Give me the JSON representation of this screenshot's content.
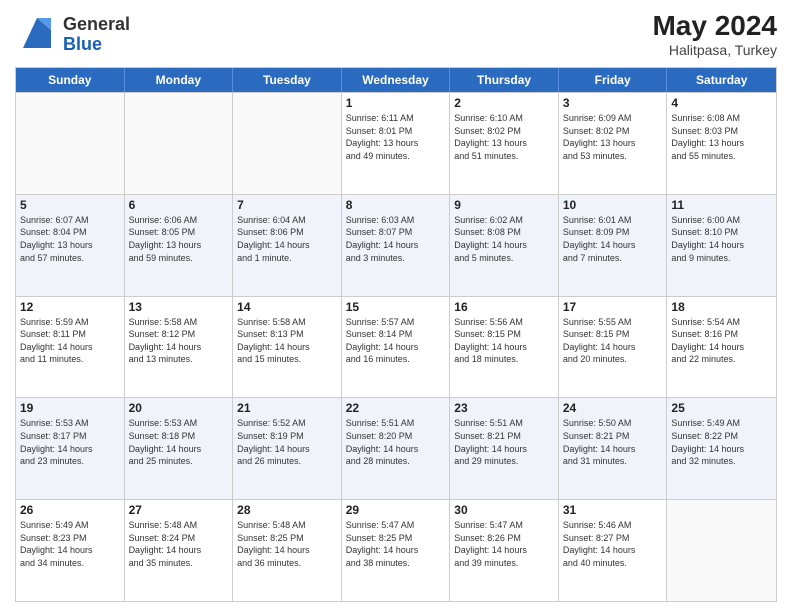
{
  "header": {
    "logo_general": "General",
    "logo_blue": "Blue",
    "month_year": "May 2024",
    "location": "Halitpasa, Turkey"
  },
  "weekdays": [
    "Sunday",
    "Monday",
    "Tuesday",
    "Wednesday",
    "Thursday",
    "Friday",
    "Saturday"
  ],
  "rows": [
    [
      {
        "day": "",
        "info": ""
      },
      {
        "day": "",
        "info": ""
      },
      {
        "day": "",
        "info": ""
      },
      {
        "day": "1",
        "info": "Sunrise: 6:11 AM\nSunset: 8:01 PM\nDaylight: 13 hours\nand 49 minutes."
      },
      {
        "day": "2",
        "info": "Sunrise: 6:10 AM\nSunset: 8:02 PM\nDaylight: 13 hours\nand 51 minutes."
      },
      {
        "day": "3",
        "info": "Sunrise: 6:09 AM\nSunset: 8:02 PM\nDaylight: 13 hours\nand 53 minutes."
      },
      {
        "day": "4",
        "info": "Sunrise: 6:08 AM\nSunset: 8:03 PM\nDaylight: 13 hours\nand 55 minutes."
      }
    ],
    [
      {
        "day": "5",
        "info": "Sunrise: 6:07 AM\nSunset: 8:04 PM\nDaylight: 13 hours\nand 57 minutes."
      },
      {
        "day": "6",
        "info": "Sunrise: 6:06 AM\nSunset: 8:05 PM\nDaylight: 13 hours\nand 59 minutes."
      },
      {
        "day": "7",
        "info": "Sunrise: 6:04 AM\nSunset: 8:06 PM\nDaylight: 14 hours\nand 1 minute."
      },
      {
        "day": "8",
        "info": "Sunrise: 6:03 AM\nSunset: 8:07 PM\nDaylight: 14 hours\nand 3 minutes."
      },
      {
        "day": "9",
        "info": "Sunrise: 6:02 AM\nSunset: 8:08 PM\nDaylight: 14 hours\nand 5 minutes."
      },
      {
        "day": "10",
        "info": "Sunrise: 6:01 AM\nSunset: 8:09 PM\nDaylight: 14 hours\nand 7 minutes."
      },
      {
        "day": "11",
        "info": "Sunrise: 6:00 AM\nSunset: 8:10 PM\nDaylight: 14 hours\nand 9 minutes."
      }
    ],
    [
      {
        "day": "12",
        "info": "Sunrise: 5:59 AM\nSunset: 8:11 PM\nDaylight: 14 hours\nand 11 minutes."
      },
      {
        "day": "13",
        "info": "Sunrise: 5:58 AM\nSunset: 8:12 PM\nDaylight: 14 hours\nand 13 minutes."
      },
      {
        "day": "14",
        "info": "Sunrise: 5:58 AM\nSunset: 8:13 PM\nDaylight: 14 hours\nand 15 minutes."
      },
      {
        "day": "15",
        "info": "Sunrise: 5:57 AM\nSunset: 8:14 PM\nDaylight: 14 hours\nand 16 minutes."
      },
      {
        "day": "16",
        "info": "Sunrise: 5:56 AM\nSunset: 8:15 PM\nDaylight: 14 hours\nand 18 minutes."
      },
      {
        "day": "17",
        "info": "Sunrise: 5:55 AM\nSunset: 8:15 PM\nDaylight: 14 hours\nand 20 minutes."
      },
      {
        "day": "18",
        "info": "Sunrise: 5:54 AM\nSunset: 8:16 PM\nDaylight: 14 hours\nand 22 minutes."
      }
    ],
    [
      {
        "day": "19",
        "info": "Sunrise: 5:53 AM\nSunset: 8:17 PM\nDaylight: 14 hours\nand 23 minutes."
      },
      {
        "day": "20",
        "info": "Sunrise: 5:53 AM\nSunset: 8:18 PM\nDaylight: 14 hours\nand 25 minutes."
      },
      {
        "day": "21",
        "info": "Sunrise: 5:52 AM\nSunset: 8:19 PM\nDaylight: 14 hours\nand 26 minutes."
      },
      {
        "day": "22",
        "info": "Sunrise: 5:51 AM\nSunset: 8:20 PM\nDaylight: 14 hours\nand 28 minutes."
      },
      {
        "day": "23",
        "info": "Sunrise: 5:51 AM\nSunset: 8:21 PM\nDaylight: 14 hours\nand 29 minutes."
      },
      {
        "day": "24",
        "info": "Sunrise: 5:50 AM\nSunset: 8:21 PM\nDaylight: 14 hours\nand 31 minutes."
      },
      {
        "day": "25",
        "info": "Sunrise: 5:49 AM\nSunset: 8:22 PM\nDaylight: 14 hours\nand 32 minutes."
      }
    ],
    [
      {
        "day": "26",
        "info": "Sunrise: 5:49 AM\nSunset: 8:23 PM\nDaylight: 14 hours\nand 34 minutes."
      },
      {
        "day": "27",
        "info": "Sunrise: 5:48 AM\nSunset: 8:24 PM\nDaylight: 14 hours\nand 35 minutes."
      },
      {
        "day": "28",
        "info": "Sunrise: 5:48 AM\nSunset: 8:25 PM\nDaylight: 14 hours\nand 36 minutes."
      },
      {
        "day": "29",
        "info": "Sunrise: 5:47 AM\nSunset: 8:25 PM\nDaylight: 14 hours\nand 38 minutes."
      },
      {
        "day": "30",
        "info": "Sunrise: 5:47 AM\nSunset: 8:26 PM\nDaylight: 14 hours\nand 39 minutes."
      },
      {
        "day": "31",
        "info": "Sunrise: 5:46 AM\nSunset: 8:27 PM\nDaylight: 14 hours\nand 40 minutes."
      },
      {
        "day": "",
        "info": ""
      }
    ]
  ]
}
